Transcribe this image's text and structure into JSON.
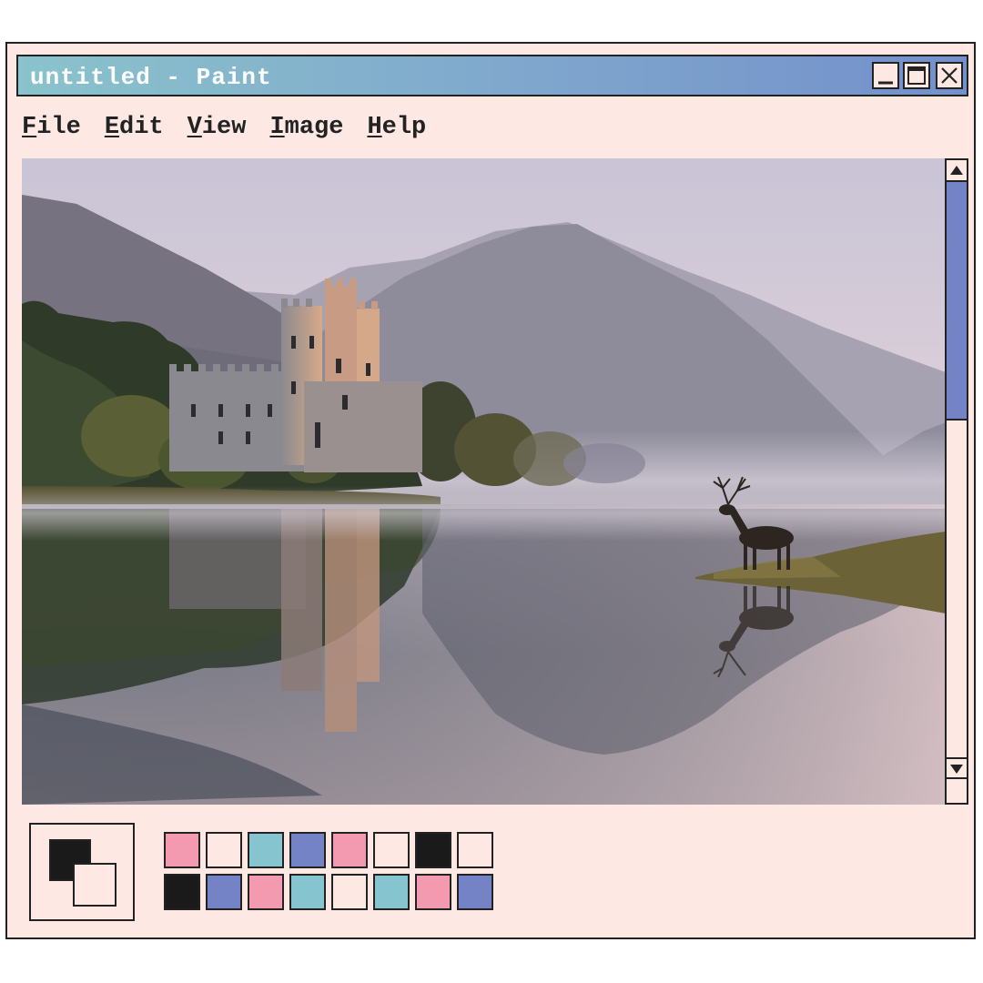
{
  "window": {
    "title": "untitled - Paint",
    "controls": {
      "minimize": "minimize",
      "maximize": "maximize",
      "close": "close"
    }
  },
  "menu": [
    {
      "mnemonic": "F",
      "rest": "ile"
    },
    {
      "mnemonic": "E",
      "rest": "dit"
    },
    {
      "mnemonic": "V",
      "rest": "iew"
    },
    {
      "mnemonic": "I",
      "rest": "mage"
    },
    {
      "mnemonic": "H",
      "rest": "elp"
    }
  ],
  "canvas": {
    "image_subject": "misty lake with castle, mountains and a stag reflected in the water"
  },
  "colors": {
    "foreground": "#1a1a1a",
    "background": "#fde8e3",
    "title_gradient": [
      "#8ac3cc",
      "#7390cb"
    ],
    "scroll_thumb": "#7383c6"
  },
  "palette": [
    "#f49ab0",
    "#fde8e3",
    "#86c4d0",
    "#7383c6",
    "#f49ab0",
    "#fde8e3",
    "#1a1a1a",
    "#fde8e3",
    "#1a1a1a",
    "#7383c6",
    "#f49ab0",
    "#86c4d0",
    "#fde8e3",
    "#86c4d0",
    "#f49ab0",
    "#7383c6"
  ],
  "icons": {
    "minimize": "minimize-icon",
    "maximize": "maximize-icon",
    "close": "close-icon",
    "scroll_up": "arrow-up-icon",
    "scroll_down": "arrow-down-icon"
  }
}
